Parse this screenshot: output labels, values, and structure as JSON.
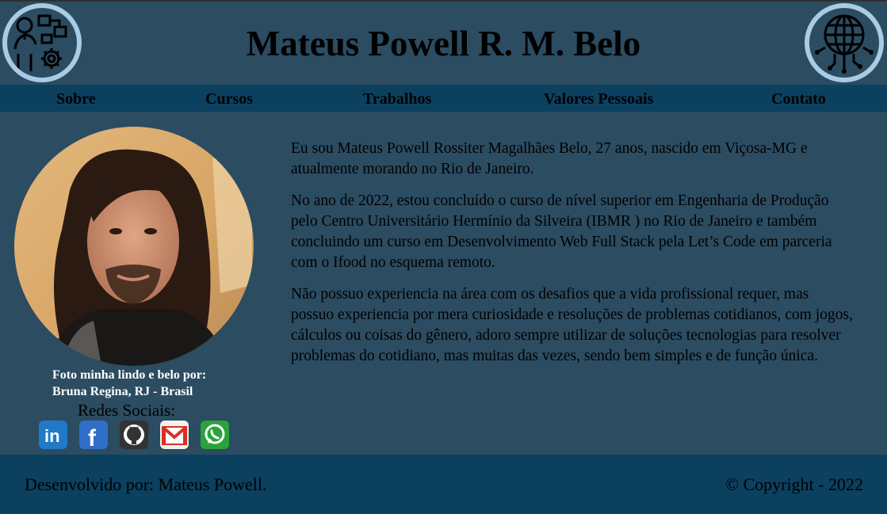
{
  "header": {
    "title": "Mateus Powell R. M. Belo",
    "left_logo": "developer-gear-icon",
    "right_logo": "globe-circuit-icon"
  },
  "nav": {
    "items": [
      {
        "label": "Sobre"
      },
      {
        "label": "Cursos"
      },
      {
        "label": "Trabalhos"
      },
      {
        "label": "Valores Pessoais"
      },
      {
        "label": "Contato"
      }
    ]
  },
  "profile": {
    "caption_line1": "Foto minha lindo e belo por:",
    "caption_line2": "Bruna Regina, RJ - Brasil",
    "social_title": "Redes Sociais:",
    "social": [
      {
        "name": "linkedin-icon",
        "color": "#1f7ac7"
      },
      {
        "name": "facebook-icon",
        "color": "#2f6fc7"
      },
      {
        "name": "github-icon",
        "color": "#333333"
      },
      {
        "name": "gmail-icon",
        "color": "#d93025"
      },
      {
        "name": "whatsapp-icon",
        "color": "#2aa33a"
      }
    ]
  },
  "about": {
    "paragraphs": [
      "Eu sou Mateus Powell Rossiter Magalhães Belo, 27 anos, nascido em Viçosa-MG e atualmente morando no Rio de Janeiro.",
      "No ano de 2022, estou concluído o curso de nível superior em Engenharia de Produção pelo Centro Universitário Hermínio da Silveira (IBMR ) no Rio de Janeiro e também concluindo um curso em Desenvolvimento Web Full Stack pela Let’s Code em parceria com o Ifood no esquema remoto.",
      "Não possuo experiencia na área com os desafios que a vida profissional requer, mas possuo experiencia por mera curiosidade e resoluções de problemas cotidianos, com jogos, cálculos ou coisas do gênero, adoro sempre utilizar de soluções tecnologias para resolver problemas do cotidiano, mas muitas das vezes, sendo bem simples e de função única."
    ]
  },
  "footer": {
    "left": "Desenvolvido por: Mateus Powell.",
    "right": "© Copyright - 2022"
  },
  "colors": {
    "page_bg": "#2b4c61",
    "nav_bg": "#0b405f",
    "footer_bg": "#0b405f",
    "logo_ring": "#a9cbe4"
  }
}
